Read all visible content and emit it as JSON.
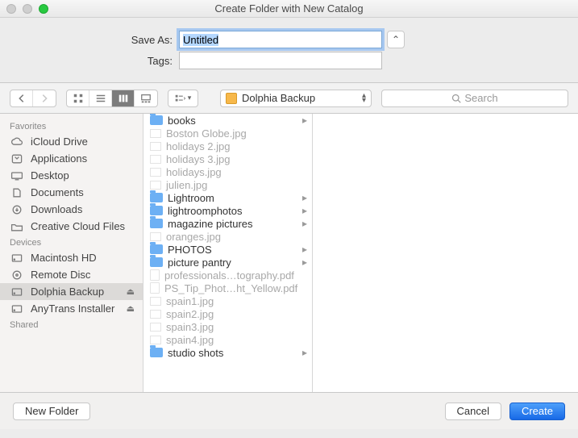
{
  "window": {
    "title": "Create Folder with New Catalog"
  },
  "fields": {
    "saveLabel": "Save As:",
    "saveValue": "Untitled",
    "tagsLabel": "Tags:",
    "tagsValue": ""
  },
  "location": {
    "name": "Dolphia Backup"
  },
  "search": {
    "placeholder": "Search"
  },
  "sidebar": {
    "headerFavorites": "Favorites",
    "headerDevices": "Devices",
    "headerShared": "Shared",
    "favorites": [
      {
        "label": "iCloud Drive",
        "icon": "cloud"
      },
      {
        "label": "Applications",
        "icon": "app"
      },
      {
        "label": "Desktop",
        "icon": "desktop"
      },
      {
        "label": "Documents",
        "icon": "doc"
      },
      {
        "label": "Downloads",
        "icon": "download"
      },
      {
        "label": "Creative Cloud Files",
        "icon": "folder"
      }
    ],
    "devices": [
      {
        "label": "Macintosh HD",
        "icon": "hd",
        "eject": false
      },
      {
        "label": "Remote Disc",
        "icon": "disc",
        "eject": false
      },
      {
        "label": "Dolphia Backup",
        "icon": "hd",
        "eject": true,
        "active": true
      },
      {
        "label": "AnyTrans Installer",
        "icon": "hd",
        "eject": true
      }
    ]
  },
  "files": [
    {
      "name": "books",
      "kind": "folder",
      "dim": false
    },
    {
      "name": "Boston Globe.jpg",
      "kind": "image",
      "dim": true
    },
    {
      "name": "holidays 2.jpg",
      "kind": "image",
      "dim": true
    },
    {
      "name": "holidays 3.jpg",
      "kind": "image",
      "dim": true
    },
    {
      "name": "holidays.jpg",
      "kind": "image",
      "dim": true
    },
    {
      "name": "julien.jpg",
      "kind": "image",
      "dim": true
    },
    {
      "name": "Lightroom",
      "kind": "folder",
      "dim": false
    },
    {
      "name": "lightroomphotos",
      "kind": "folder",
      "dim": false
    },
    {
      "name": "magazine pictures",
      "kind": "folder",
      "dim": false
    },
    {
      "name": "oranges.jpg",
      "kind": "image",
      "dim": true
    },
    {
      "name": "PHOTOS",
      "kind": "folder",
      "dim": false
    },
    {
      "name": "picture pantry",
      "kind": "folder",
      "dim": false
    },
    {
      "name": "professionals…tography.pdf",
      "kind": "file",
      "dim": true
    },
    {
      "name": "PS_Tip_Phot…ht_Yellow.pdf",
      "kind": "file",
      "dim": true
    },
    {
      "name": "spain1.jpg",
      "kind": "image",
      "dim": true
    },
    {
      "name": "spain2.jpg",
      "kind": "image",
      "dim": true
    },
    {
      "name": "spain3.jpg",
      "kind": "image",
      "dim": true
    },
    {
      "name": "spain4.jpg",
      "kind": "image",
      "dim": true
    },
    {
      "name": "studio shots",
      "kind": "folder",
      "dim": false
    }
  ],
  "buttons": {
    "newFolder": "New Folder",
    "cancel": "Cancel",
    "create": "Create"
  }
}
